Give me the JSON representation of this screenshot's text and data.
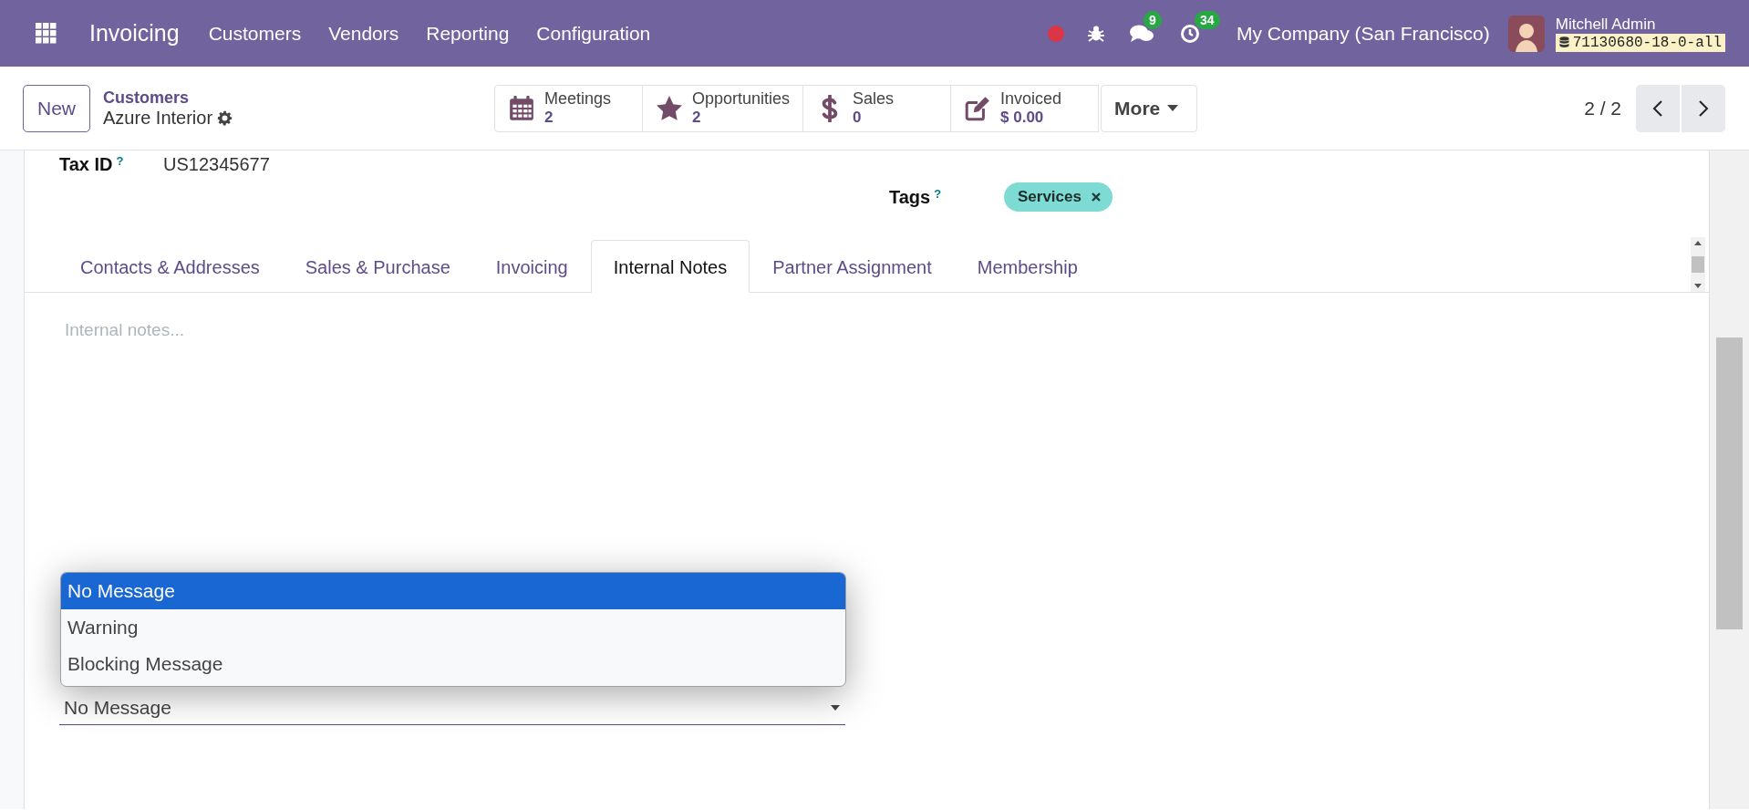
{
  "navbar": {
    "app": "Invoicing",
    "menu": [
      "Customers",
      "Vendors",
      "Reporting",
      "Configuration"
    ],
    "chat_count": "9",
    "activity_count": "34",
    "company": "My Company (San Francisco)",
    "user": "Mitchell Admin",
    "database": "71130680-18-0-all"
  },
  "control_panel": {
    "new_button": "New",
    "breadcrumb": "Customers",
    "record": "Azure Interior",
    "smart_buttons": [
      {
        "kind": "calendar",
        "label": "Meetings",
        "value": "2"
      },
      {
        "kind": "star",
        "label": "Opportunities",
        "value": "2"
      },
      {
        "kind": "dollar",
        "label": "Sales",
        "value": "0"
      },
      {
        "kind": "edit",
        "label": "Invoiced",
        "value": "$ 0.00"
      }
    ],
    "more": "More",
    "pager": "2 / 2"
  },
  "form": {
    "tax_id": {
      "label": "Tax ID",
      "help": "?",
      "value": "US12345677"
    },
    "tags": {
      "label": "Tags",
      "help": "?",
      "items": [
        "Services"
      ]
    }
  },
  "tabs": [
    {
      "label": "Contacts & Addresses",
      "selected": false
    },
    {
      "label": "Sales & Purchase",
      "selected": false
    },
    {
      "label": "Invoicing",
      "selected": false
    },
    {
      "label": "Internal Notes",
      "selected": true
    },
    {
      "label": "Partner Assignment",
      "selected": false
    },
    {
      "label": "Membership",
      "selected": false
    }
  ],
  "notes": {
    "placeholder": "Internal notes..."
  },
  "message_select": {
    "value": "No Message",
    "options": [
      {
        "label": "No Message",
        "selected": true
      },
      {
        "label": "Warning",
        "selected": false
      },
      {
        "label": "Blocking Message",
        "selected": false
      }
    ]
  }
}
